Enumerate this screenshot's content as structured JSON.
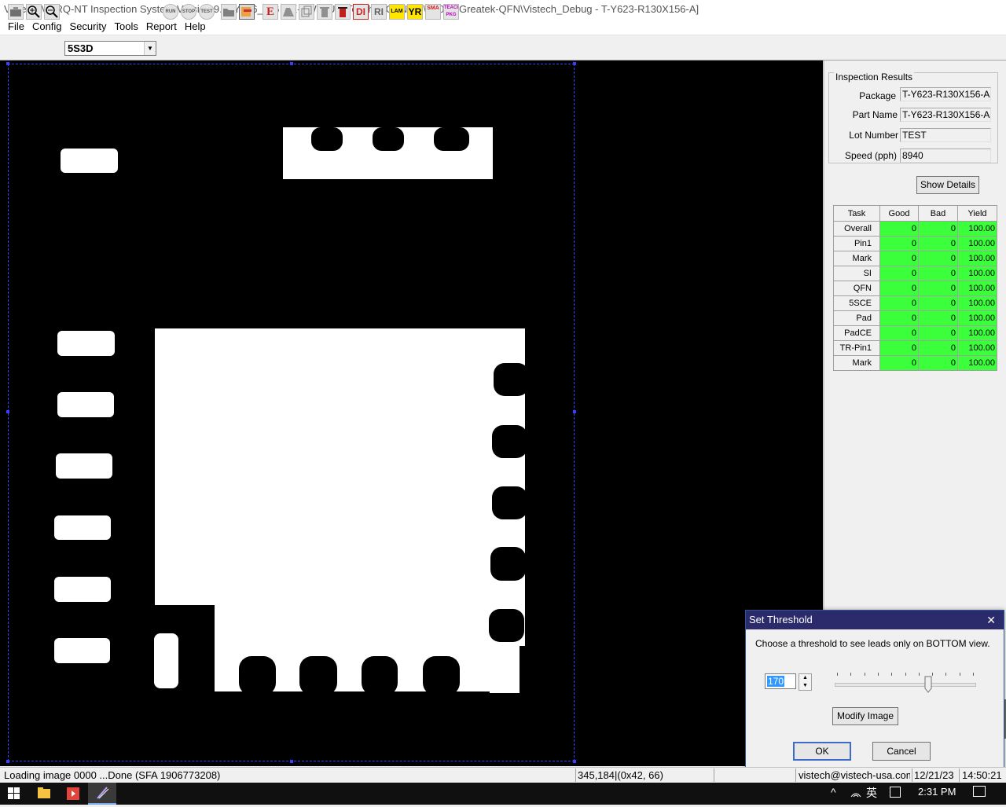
{
  "window": {
    "title": "Vistech MARQ-NT Inspection System Version 9.07Y286_6 GIGE-TW00U1 [Teach] - QFN [D:\\V2036-Greatek-QFN\\Vistech_Debug - T-Y623-R130X156-A]"
  },
  "menu": [
    "File",
    "Config",
    "Security",
    "Tools",
    "Report",
    "Help"
  ],
  "toolbar": {
    "buttons": [
      "camera-icon",
      "zoom-in-icon",
      "zoom-out-icon",
      "RUN",
      "STOP",
      "TEST",
      "open-folder-icon",
      "teach-icon",
      "E",
      "triangle-icon",
      "copy-icon",
      "trash-icon",
      "bin-icon",
      "DI",
      "RI",
      "LAM",
      "YR",
      "SMA",
      "TEACH-PKG"
    ],
    "combo_value": "5S3D"
  },
  "inspection_results": {
    "group_title": "Inspection Results",
    "fields": [
      {
        "label": "Package",
        "value": "T-Y623-R130X156-A"
      },
      {
        "label": "Part Name",
        "value": "T-Y623-R130X156-A"
      },
      {
        "label": "Lot Number",
        "value": "TEST"
      },
      {
        "label": "Speed (pph)",
        "value": "8940"
      }
    ],
    "show_details_label": "Show Details"
  },
  "task_table": {
    "headers": [
      "Task",
      "Good",
      "Bad",
      "Yield"
    ],
    "rows": [
      {
        "task": "Overall",
        "good": "0",
        "bad": "0",
        "yield": "100.00"
      },
      {
        "task": "Pin1",
        "good": "0",
        "bad": "0",
        "yield": "100.00"
      },
      {
        "task": "Mark",
        "good": "0",
        "bad": "0",
        "yield": "100.00"
      },
      {
        "task": "SI",
        "good": "0",
        "bad": "0",
        "yield": "100.00"
      },
      {
        "task": "QFN",
        "good": "0",
        "bad": "0",
        "yield": "100.00"
      },
      {
        "task": "5SCE",
        "good": "0",
        "bad": "0",
        "yield": "100.00"
      },
      {
        "task": "Pad",
        "good": "0",
        "bad": "0",
        "yield": "100.00"
      },
      {
        "task": "PadCE",
        "good": "0",
        "bad": "0",
        "yield": "100.00"
      },
      {
        "task": "TR-Pin1",
        "good": "0",
        "bad": "0",
        "yield": "100.00"
      },
      {
        "task": "Mark",
        "good": "0",
        "bad": "0",
        "yield": "100.00"
      }
    ],
    "good_color": "#3cff3c"
  },
  "dialog": {
    "title": "Set Threshold",
    "instruction": "Choose a threshold to see leads only on BOTTOM view.",
    "threshold_value": "170",
    "threshold_level": 170,
    "modify_label": "Modify Image",
    "ok_label": "OK",
    "cancel_label": "Cancel",
    "close_glyph": "✕"
  },
  "status": {
    "message": "Loading image 0000 ...Done (SFA 1906773208)",
    "coords": "345,184|(0x42,  66)",
    "email": "vistech@vistech-usa.com",
    "date": "12/21/23",
    "time": "14:50:21"
  },
  "taskbar": {
    "clock": "2:31 PM",
    "ime": "英"
  }
}
